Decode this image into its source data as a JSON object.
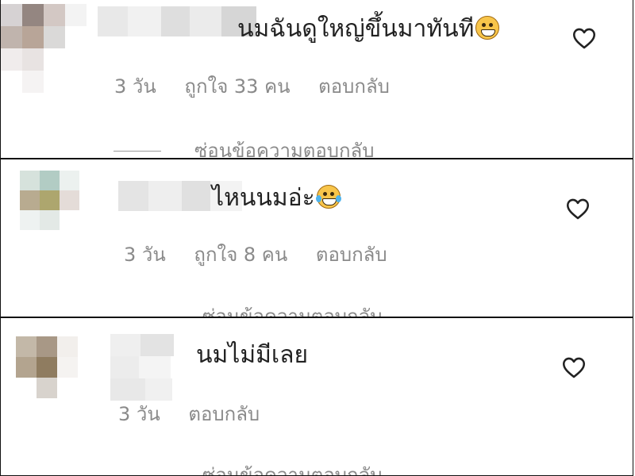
{
  "comments": [
    {
      "text": "นมฉันดูใหญ่ขึ้นมาทันที",
      "emoji": "grinning-face-emoji",
      "time": "3 วัน",
      "likes": "ถูกใจ 33 คน",
      "reply": "ตอบกลับ",
      "hide_replies": "ซ่อนข้อความตอบกลับ",
      "avatar_colors": [
        "#d6d2d3",
        "#948681",
        "#d3c8c4",
        "#f3f3f3",
        "#c0b4ad",
        "#b8a598",
        "#dad9d8",
        "#ffffff",
        "#f0ecec",
        "#e8e3e2",
        "#ffffff",
        "#ffffff",
        "#ffffff",
        "#f5f3f3",
        "#ffffff",
        "#ffffff"
      ],
      "name_colors": [
        "#e8e8e8",
        "#f1f1f1",
        "#dedede",
        "#ebebeb",
        "#d6d6d6"
      ]
    },
    {
      "text": "ไหนนมอ่ะ",
      "emoji": "tears-of-joy-emoji",
      "time": "3 วัน",
      "likes": "ถูกใจ 8 คน",
      "reply": "ตอบกลับ",
      "hide_replies": "ซ่อนข้อความตอบกลับ",
      "avatar_colors": [
        "#d6e2dc",
        "#b2ccc4",
        "#ecf1ef",
        "#ffffff",
        "#b8ab90",
        "#ada66e",
        "#e4dcd8",
        "#ffffff",
        "#eef2f1",
        "#e3e9e6",
        "#ffffff",
        "#ffffff",
        "#ffffff",
        "#ffffff",
        "#ffffff",
        "#ffffff"
      ],
      "name_colors": [
        "#e4e4e4",
        "#eeeeee",
        "#e0e0e0",
        "#f3f3f3"
      ]
    },
    {
      "text": "นมไม่มีเลย",
      "emoji": "",
      "time": "3 วัน",
      "likes": "",
      "reply": "ตอบกลับ",
      "hide_replies": "ซ่อนข้อความตอบกลับ",
      "avatar_colors": [
        "#c3b8a8",
        "#a89886",
        "#f2efec",
        "#ffffff",
        "#b3a48f",
        "#8f7c60",
        "#f5f3f1",
        "#ffffff",
        "#ffffff",
        "#d8d3cd",
        "#ffffff",
        "#ffffff",
        "#ffffff",
        "#ffffff",
        "#ffffff",
        "#ffffff"
      ],
      "name_colors": [
        "#efefef",
        "#e3e3e3",
        "#ececec",
        "#f4f4f4",
        "#e8e8e8",
        "#f0f0f0"
      ]
    }
  ]
}
